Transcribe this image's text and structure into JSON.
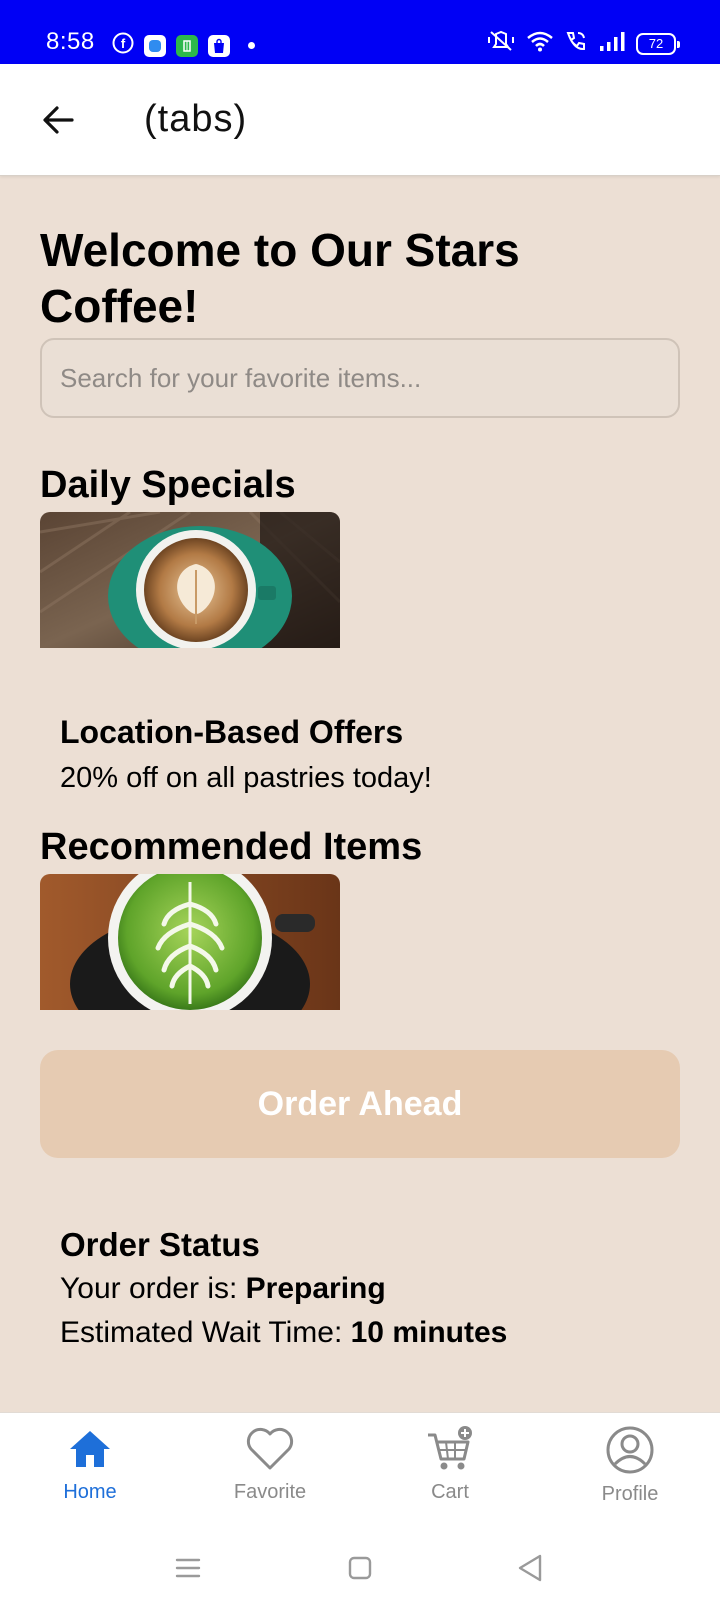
{
  "status_bar": {
    "time": "8:58",
    "battery": "72",
    "bg_color": "#0000F5"
  },
  "header": {
    "title": "(tabs)"
  },
  "main": {
    "welcome": "Welcome to Our Stars Coffee!",
    "search_placeholder": "Search for your favorite items...",
    "daily_specials_title": "Daily Specials",
    "offers_title": "Location-Based Offers",
    "offers_text": "20% off on all pastries today!",
    "recommended_title": "Recommended Items",
    "order_button": "Order Ahead",
    "order_status": {
      "title": "Order Status",
      "order_label": "Your order is: ",
      "order_value": "Preparing",
      "wait_label": "Estimated Wait Time: ",
      "wait_value": "10 minutes"
    }
  },
  "tabs": [
    {
      "label": "Home",
      "icon": "home-icon",
      "active": true
    },
    {
      "label": "Favorite",
      "icon": "heart-icon",
      "active": false
    },
    {
      "label": "Cart",
      "icon": "cart-icon",
      "active": false
    },
    {
      "label": "Profile",
      "icon": "profile-icon",
      "active": false
    }
  ],
  "colors": {
    "background": "#ECDFD4",
    "accent": "#1E6FD9",
    "order_button": "#E6CBB2"
  }
}
